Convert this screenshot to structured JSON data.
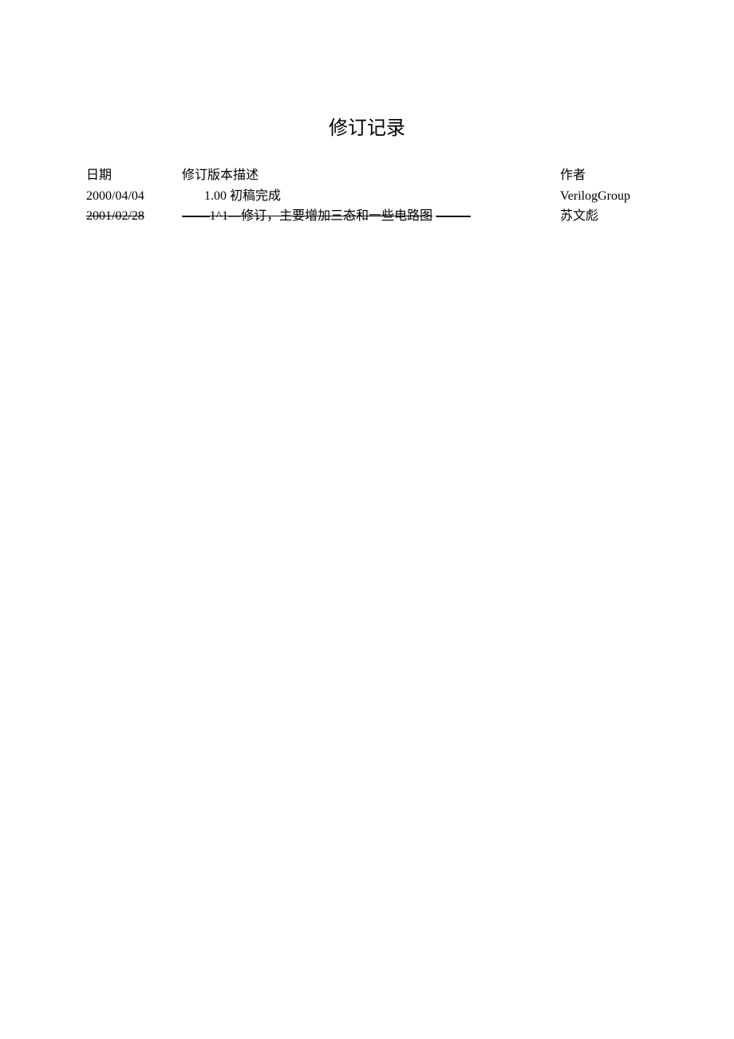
{
  "title": "修订记录",
  "headers": {
    "date": "日期",
    "version_desc": "修订版本描述",
    "author": "作者"
  },
  "rows": [
    {
      "date": "2000/04/04",
      "version": "1.00",
      "desc": "初稿完成",
      "author": "VerilogGroup",
      "struck": false
    },
    {
      "date": "2001/02/28",
      "dash1": "--------",
      "version": "1^1",
      "dash_mid": "—",
      "desc": "修订，主要增加三态和一些电路图",
      "dash2": "----------",
      "author": "苏文彪",
      "struck": true
    }
  ]
}
